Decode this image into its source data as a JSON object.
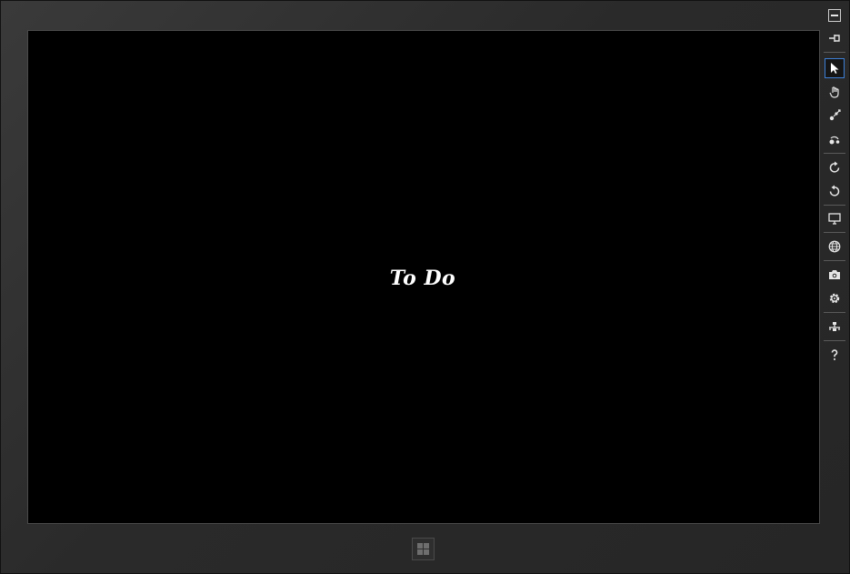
{
  "app": {
    "logo_text": "To Do"
  },
  "toolbar": {
    "tools": [
      {
        "name": "minimize",
        "icon": "minimize-icon",
        "selected": false
      },
      {
        "name": "always-on-top",
        "icon": "pin-icon",
        "selected": false
      },
      {
        "name": "mouse-mode",
        "icon": "pointer-arrow-icon",
        "selected": true
      },
      {
        "name": "touch-mode",
        "icon": "hand-icon",
        "selected": false
      },
      {
        "name": "pinch-zoom",
        "icon": "pinch-zoom-icon",
        "selected": false
      },
      {
        "name": "rotation-touch",
        "icon": "rotate-touch-icon",
        "selected": false
      },
      {
        "name": "rotate-clockwise",
        "icon": "rotate-clockwise-icon",
        "selected": false
      },
      {
        "name": "rotate-counterclockwise",
        "icon": "rotate-counterclockwise-icon",
        "selected": false
      },
      {
        "name": "change-resolution",
        "icon": "monitor-icon",
        "selected": false
      },
      {
        "name": "set-location",
        "icon": "globe-icon",
        "selected": false
      },
      {
        "name": "screenshot",
        "icon": "camera-icon",
        "selected": false
      },
      {
        "name": "settings",
        "icon": "gear-icon",
        "selected": false
      },
      {
        "name": "network",
        "icon": "network-icon",
        "selected": false
      },
      {
        "name": "help",
        "icon": "help-icon",
        "selected": false
      }
    ]
  },
  "colors": {
    "bezel": "#2b2b2b",
    "screen": "#000000",
    "selected_border": "#3d7fd6",
    "icon": "#e6e6e6"
  },
  "windows_button": {
    "icon": "windows-logo-icon"
  }
}
